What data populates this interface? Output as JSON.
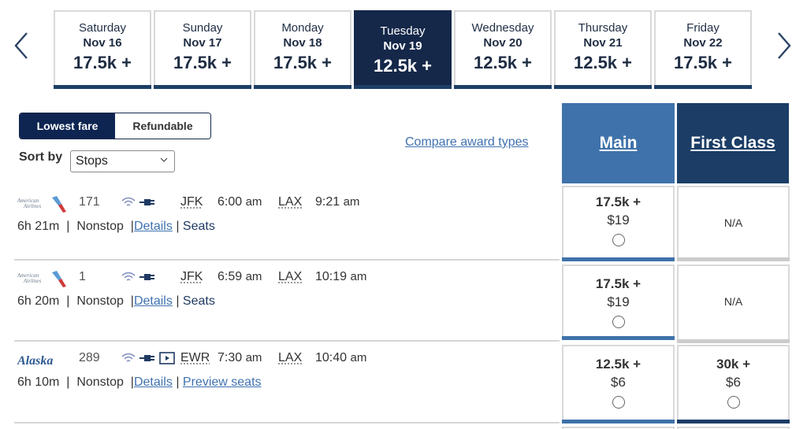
{
  "date_nav": {
    "prev_icon": "chevron-left-icon",
    "next_icon": "chevron-right-icon",
    "dates": [
      {
        "day": "Saturday",
        "date": "Nov 16",
        "points": "17.5k +",
        "selected": false
      },
      {
        "day": "Sunday",
        "date": "Nov 17",
        "points": "17.5k +",
        "selected": false
      },
      {
        "day": "Monday",
        "date": "Nov 18",
        "points": "17.5k +",
        "selected": false
      },
      {
        "day": "Tuesday",
        "date": "Nov 19",
        "points": "12.5k +",
        "selected": true
      },
      {
        "day": "Wednesday",
        "date": "Nov 20",
        "points": "12.5k +",
        "selected": false
      },
      {
        "day": "Thursday",
        "date": "Nov 21",
        "points": "12.5k +",
        "selected": false
      },
      {
        "day": "Friday",
        "date": "Nov 22",
        "points": "17.5k +",
        "selected": false
      }
    ]
  },
  "fare_toggle": {
    "options": [
      "Lowest fare",
      "Refundable"
    ],
    "active": "Lowest fare"
  },
  "sort": {
    "label": "Sort by",
    "selected": "Stops"
  },
  "compare_link": "Compare award types",
  "cabins": {
    "main": "Main",
    "first": "First Class"
  },
  "colors": {
    "selected_date_bg": "#15284a",
    "main_header": "#3f72aa",
    "first_header": "#1b3d66",
    "link": "#3f72af"
  },
  "flights": [
    {
      "airline": "American Airlines",
      "logo_line1": "American",
      "logo_line2": "Airlines",
      "flight_number": "171",
      "amenities": [
        "wifi-icon",
        "power-icon"
      ],
      "origin": "JFK",
      "depart": "6:00",
      "depart_ampm": "am",
      "destination": "LAX",
      "arrive": "9:21",
      "arrive_ampm": "am",
      "duration": "6h 21m",
      "stops": "Nonstop",
      "details_link": "Details",
      "seats_label": "Seats",
      "main": {
        "miles": "17.5k +",
        "tax": "$19"
      },
      "first": {
        "na": "N/A"
      }
    },
    {
      "airline": "American Airlines",
      "logo_line1": "American",
      "logo_line2": "Airlines",
      "flight_number": "1",
      "amenities": [
        "wifi-icon",
        "power-icon"
      ],
      "origin": "JFK",
      "depart": "6:59",
      "depart_ampm": "am",
      "destination": "LAX",
      "arrive": "10:19",
      "arrive_ampm": "am",
      "duration": "6h 20m",
      "stops": "Nonstop",
      "details_link": "Details",
      "seats_label": "Seats",
      "main": {
        "miles": "17.5k +",
        "tax": "$19"
      },
      "first": {
        "na": "N/A"
      }
    },
    {
      "airline": "Alaska",
      "logo_text": "Alaska",
      "flight_number": "289",
      "amenities": [
        "wifi-icon",
        "power-icon",
        "video-icon"
      ],
      "origin": "EWR",
      "depart": "7:30",
      "depart_ampm": "am",
      "destination": "LAX",
      "arrive": "10:40",
      "arrive_ampm": "am",
      "duration": "6h 10m",
      "stops": "Nonstop",
      "details_link": "Details",
      "seats_label": "Preview seats",
      "main": {
        "miles": "12.5k +",
        "tax": "$6"
      },
      "first": {
        "miles": "30k +",
        "tax": "$6"
      }
    }
  ],
  "separator": "|"
}
